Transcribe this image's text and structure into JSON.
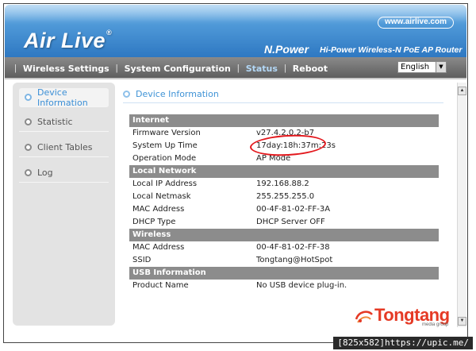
{
  "header": {
    "logo_text": "Air Live",
    "logo_reg": "®",
    "url": "www.airlive.com",
    "product_name": "N.Power",
    "tagline": "Hi-Power Wireless-N PoE AP Router"
  },
  "nav": {
    "items": [
      {
        "label": "Wireless Settings"
      },
      {
        "label": "System Configuration"
      },
      {
        "label": "Status"
      },
      {
        "label": "Reboot"
      }
    ],
    "active": "Status",
    "language": "English"
  },
  "sidebar": {
    "items": [
      {
        "label": "Device Information"
      },
      {
        "label": "Statistic"
      },
      {
        "label": "Client Tables"
      },
      {
        "label": "Log"
      }
    ],
    "active": "Device Information"
  },
  "main": {
    "title": "Device Information",
    "sections": [
      {
        "name": "Internet",
        "rows": [
          {
            "key": "Firmware Version",
            "value": "v27.4.2.0.2-b7"
          },
          {
            "key": "System Up Time",
            "value": "17day:18h:37m:23s"
          },
          {
            "key": "Operation Mode",
            "value": "AP Mode"
          }
        ]
      },
      {
        "name": "Local Network",
        "rows": [
          {
            "key": "Local IP Address",
            "value": "192.168.88.2"
          },
          {
            "key": "Local Netmask",
            "value": "255.255.255.0"
          },
          {
            "key": "MAC Address",
            "value": "00-4F-81-02-FF-3A"
          },
          {
            "key": "DHCP Type",
            "value": "DHCP Server OFF"
          }
        ]
      },
      {
        "name": "Wireless",
        "rows": [
          {
            "key": "MAC Address",
            "value": "00-4F-81-02-FF-38"
          },
          {
            "key": "SSID",
            "value": "Tongtang@HotSpot"
          }
        ]
      },
      {
        "name": "USB Information",
        "rows": [
          {
            "key": "Product Name",
            "value": "No USB device plug-in."
          }
        ]
      }
    ]
  },
  "watermark": {
    "brand": "Tongtang",
    "sub": "media group"
  },
  "footer": {
    "label": "[825x582]https://upic.me/"
  },
  "colors": {
    "header_blue": "#2e78c2",
    "nav_gray": "#6e6e6e",
    "section_gray": "#8c8c8c",
    "accent_blue": "#3f93d6",
    "annotation_red": "#e3181d"
  }
}
